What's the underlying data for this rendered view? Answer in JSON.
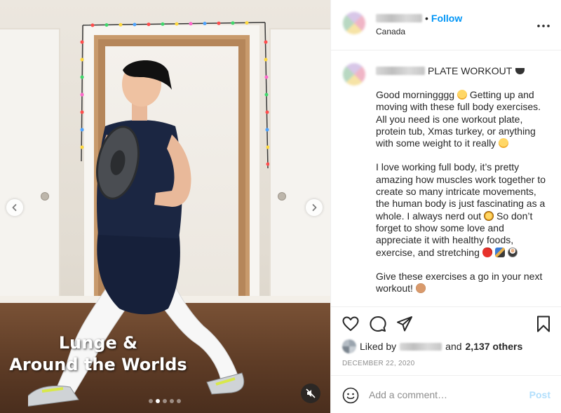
{
  "media": {
    "overlay_caption_line1": "Lunge &",
    "overlay_caption_line2": "Around the Worlds",
    "carousel_total": 5,
    "carousel_active_index": 1,
    "muted": true
  },
  "header": {
    "location": "Canada",
    "separator": "•",
    "follow_label": "Follow"
  },
  "caption": {
    "title": "PLATE WORKOUT",
    "paragraph1_a": "Good morningggg",
    "paragraph1_b": "Getting up and moving with these full body exercises. All you need is one workout plate, protein tub, Xmas turkey, or anything with some weight to it really",
    "paragraph2_a": "I love working full body, it’s pretty amazing how muscles work together to create so many intricate movements, the human body is just fascinating as a whole. I always nerd out",
    "paragraph2_b": "So don’t forget to show some love and appreciate it with healthy foods, exercise, and stretching",
    "paragraph3": "Give these exercises a go in your next workout!"
  },
  "likes": {
    "prefix": "Liked by",
    "and_label": "and",
    "others_label": "2,137 others"
  },
  "date": "DECEMBER 22, 2020",
  "add_comment": {
    "placeholder": "Add a comment…",
    "post_label": "Post"
  },
  "colors": {
    "accent": "#0095f6",
    "post_disabled": "#b2dffc",
    "meta": "#8e8e8e"
  }
}
